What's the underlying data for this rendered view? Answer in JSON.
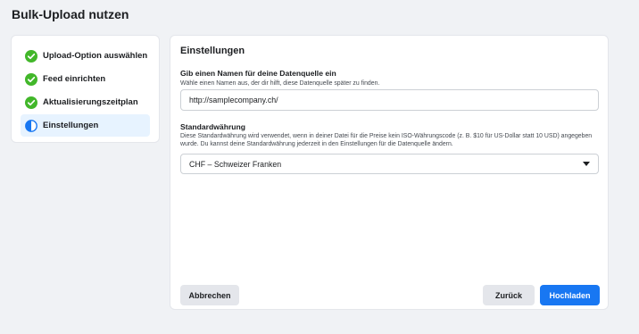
{
  "page": {
    "title": "Bulk-Upload nutzen"
  },
  "steps": [
    {
      "label": "Upload-Option auswählen",
      "status": "done",
      "icon": "check-circle-icon"
    },
    {
      "label": "Feed einrichten",
      "status": "done",
      "icon": "check-circle-icon"
    },
    {
      "label": "Aktualisierungszeitplan",
      "status": "done",
      "icon": "check-circle-icon"
    },
    {
      "label": "Einstellungen",
      "status": "current",
      "icon": "half-circle-icon"
    }
  ],
  "settings": {
    "title": "Einstellungen",
    "datasource_name": {
      "label": "Gib einen Namen für deine Datenquelle ein",
      "help": "Wähle einen Namen aus, der dir hilft, diese Datenquelle später zu finden.",
      "value": "http://samplecompany.ch/"
    },
    "currency": {
      "label": "Standardwährung",
      "help": "Diese Standardwährung wird verwendet, wenn in deiner Datei für die Preise kein ISO-Währungscode (z. B. $10 für US-Dollar statt 10 USD) angegeben wurde. Du kannst deine Standardwährung jederzeit in den Einstellungen für die Datenquelle ändern.",
      "selected": "CHF – Schweizer Franken"
    }
  },
  "footer": {
    "cancel_label": "Abbrechen",
    "back_label": "Zurück",
    "upload_label": "Hochladen"
  },
  "colors": {
    "success": "#42b72a",
    "primary": "#1877f2",
    "active_bg": "#e7f3ff"
  }
}
